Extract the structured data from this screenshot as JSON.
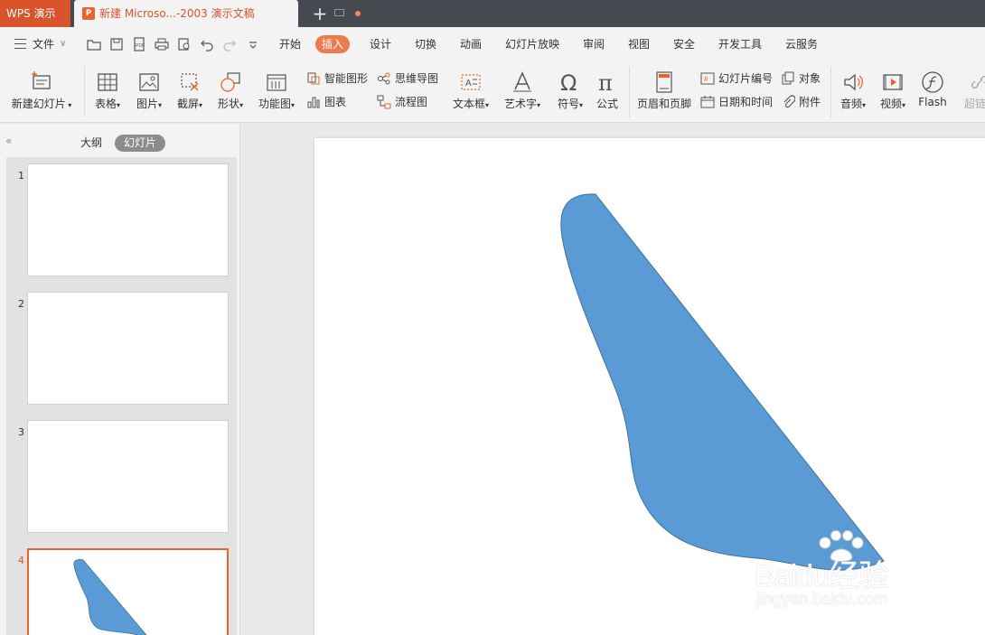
{
  "titlebar": {
    "app_label": "WPS 演示",
    "document_tab": "新建 Microso...-2003 演示文稿",
    "new_tab": "+"
  },
  "menubar": {
    "file_label": "文件",
    "items": [
      {
        "label": "开始",
        "active": false
      },
      {
        "label": "插入",
        "active": true
      },
      {
        "label": "设计",
        "active": false
      },
      {
        "label": "切换",
        "active": false
      },
      {
        "label": "动画",
        "active": false
      },
      {
        "label": "幻灯片放映",
        "active": false
      },
      {
        "label": "审阅",
        "active": false
      },
      {
        "label": "视图",
        "active": false
      },
      {
        "label": "安全",
        "active": false
      },
      {
        "label": "开发工具",
        "active": false
      },
      {
        "label": "云服务",
        "active": false
      }
    ]
  },
  "ribbon": {
    "new_slide": "新建幻灯片",
    "table": "表格",
    "picture": "图片",
    "screenshot": "截屏",
    "shape": "形状",
    "function_chart": "功能图",
    "smart_art": "智能图形",
    "chart": "图表",
    "mind_map": "思维导图",
    "flowchart": "流程图",
    "text_box": "文本框",
    "word_art": "艺术字",
    "symbol": "符号",
    "formula": "公式",
    "header_footer": "页眉和页脚",
    "slide_number": "幻灯片编号",
    "date_time": "日期和时间",
    "object": "对象",
    "attachment": "附件",
    "audio": "音频",
    "video": "视频",
    "flash": "Flash",
    "hyperlink": "超链"
  },
  "panel": {
    "tab_outline": "大纲",
    "tab_slides": "幻灯片",
    "collapse_icon": "«",
    "slides": [
      {
        "number": "1",
        "active": false
      },
      {
        "number": "2",
        "active": false
      },
      {
        "number": "3",
        "active": false
      },
      {
        "number": "4",
        "active": true
      }
    ]
  },
  "shape_color": "#5b9bd5",
  "accent": "#d8552c",
  "watermark": {
    "main": "Baidu经验",
    "sub": "jingyan.baidu.com"
  }
}
